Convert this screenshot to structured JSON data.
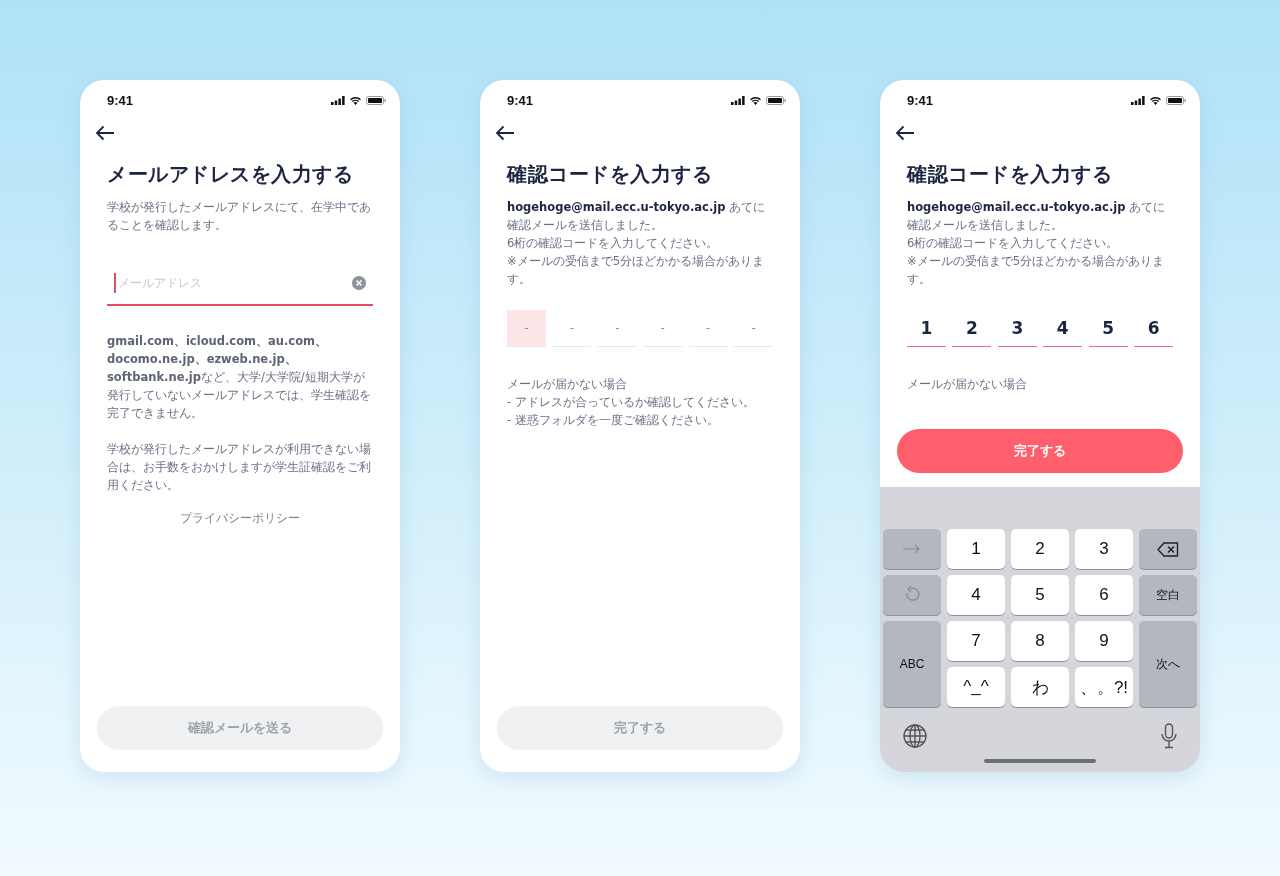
{
  "screens": [
    {
      "kind": "email",
      "time": "9:41",
      "title": "メールアドレスを入力する",
      "description": [
        "学校が発行したメールアドレスにて、在学中であることを確認します。"
      ],
      "email_field": {
        "placeholder": "メールアドレス",
        "focused": true
      },
      "notes": [
        "**gmail.com、icloud.com、au.com、docomo.ne.jp、ezweb.ne.jp、softbank.ne.jp**など、大学/大学院/短期大学が発行していないメールアドレスでは、学生確認を完了できません。",
        "学校が発行したメールアドレスが利用できない場合は、お手数をおかけしますが学生証確認をご利用ください。"
      ],
      "link": "プライバシーポリシー",
      "button": {
        "label": "確認メールを送る",
        "disabled": true
      }
    },
    {
      "kind": "code",
      "time": "9:41",
      "title": "確認コードを入力する",
      "description": [
        "**hogehoge@mail.ecc.u-tokyo.ac.jp** あてに確認メールを送信しました。",
        "6桁の確認コードを入力してください。",
        "※メールの受信まで5分ほどかかる場合があります。"
      ],
      "digits": [
        {
          "value": "-",
          "selected": true,
          "filled": false
        },
        {
          "value": "-",
          "selected": false,
          "filled": false
        },
        {
          "value": "-",
          "selected": false,
          "filled": false
        },
        {
          "value": "-",
          "selected": false,
          "filled": false
        },
        {
          "value": "-",
          "selected": false,
          "filled": false
        },
        {
          "value": "-",
          "selected": false,
          "filled": false
        }
      ],
      "help": [
        "メールが届かない場合",
        "- アドレスが合っているか確認してください。",
        "- 迷惑フォルダを一度ご確認ください。"
      ],
      "button": {
        "label": "完了する",
        "disabled": true
      }
    },
    {
      "kind": "code",
      "time": "9:41",
      "title": "確認コードを入力する",
      "description": [
        "**hogehoge@mail.ecc.u-tokyo.ac.jp** あてに確認メールを送信しました。",
        "6桁の確認コードを入力してください。",
        "※メールの受信まで5分ほどかかる場合があります。"
      ],
      "digits": [
        {
          "value": "1",
          "selected": false,
          "filled": true
        },
        {
          "value": "2",
          "selected": false,
          "filled": true
        },
        {
          "value": "3",
          "selected": false,
          "filled": true
        },
        {
          "value": "4",
          "selected": false,
          "filled": true
        },
        {
          "value": "5",
          "selected": false,
          "filled": true
        },
        {
          "value": "6",
          "selected": false,
          "filled": true
        }
      ],
      "help": [
        "メールが届かない場合"
      ],
      "button": {
        "label": "完了する",
        "disabled": false
      },
      "keyboard": {
        "keys": [
          {
            "kind": "next-field"
          },
          {
            "kind": "digit",
            "label": "1"
          },
          {
            "kind": "digit",
            "label": "2"
          },
          {
            "kind": "digit",
            "label": "3"
          },
          {
            "kind": "delete"
          },
          {
            "kind": "undo"
          },
          {
            "kind": "digit",
            "label": "4"
          },
          {
            "kind": "digit",
            "label": "5"
          },
          {
            "kind": "digit",
            "label": "6"
          },
          {
            "kind": "action",
            "label": "空白"
          },
          {
            "kind": "tall",
            "label": "ABC"
          },
          {
            "kind": "digit",
            "label": "7"
          },
          {
            "kind": "digit",
            "label": "8"
          },
          {
            "kind": "digit",
            "label": "9"
          },
          {
            "kind": "tall",
            "label": "次へ"
          },
          {
            "kind": "digit",
            "label": "^_^"
          },
          {
            "kind": "digit",
            "label": "わ"
          },
          {
            "kind": "digit",
            "label": "、。?!"
          }
        ]
      }
    }
  ]
}
